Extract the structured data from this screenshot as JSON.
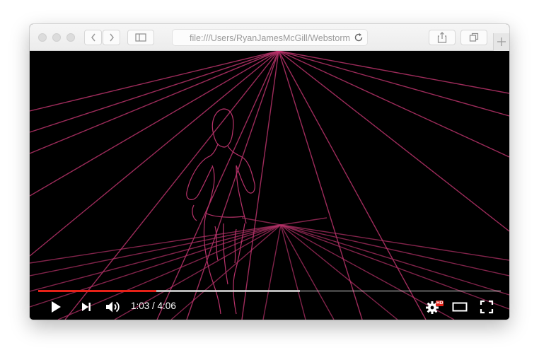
{
  "browser": {
    "url": "file:///Users/RyanJamesMcGill/Webstorm",
    "new_tab_symbol": "+",
    "icons": [
      "back-icon",
      "forward-icon",
      "sidebar-icon",
      "reload-icon",
      "share-icon",
      "tabs-icon",
      "plus-icon"
    ]
  },
  "player": {
    "current_time": "1:03",
    "time_separator": " / ",
    "duration": "4:06",
    "played_fraction": 0.256,
    "buffered_fraction": 0.565,
    "hd_badge": "HD",
    "accent_color": "#e62117",
    "line_color": "#b8326a",
    "icons": [
      "play-icon",
      "next-icon",
      "volume-icon",
      "settings-icon",
      "theater-mode-icon",
      "fullscreen-icon"
    ]
  }
}
